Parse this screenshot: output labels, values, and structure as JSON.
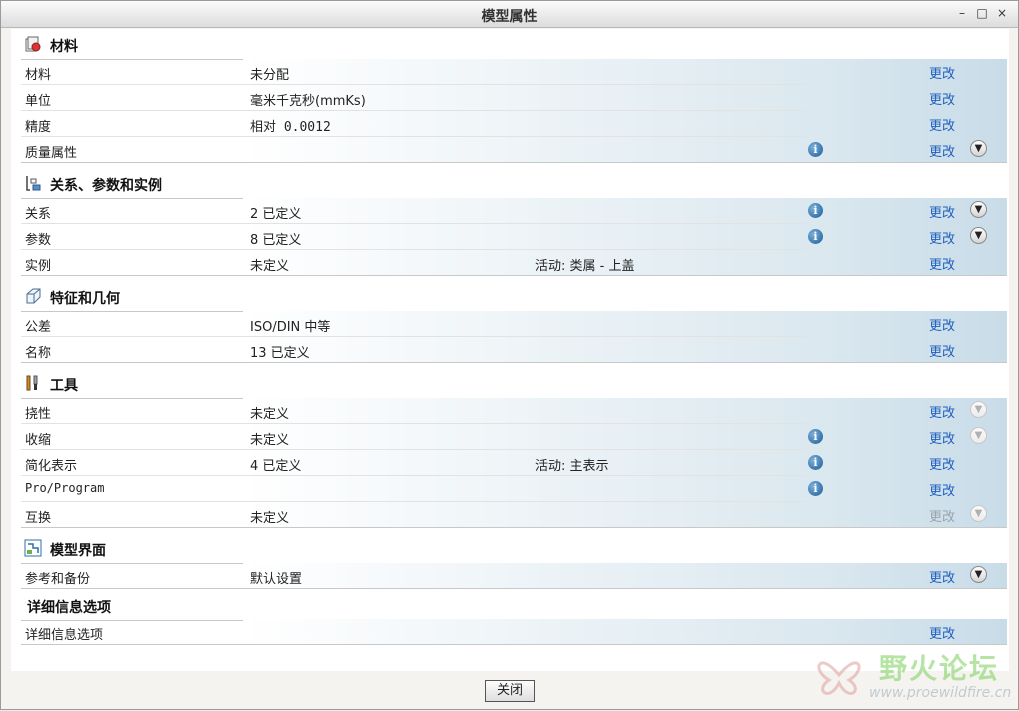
{
  "window": {
    "title": "模型属性",
    "controls": {
      "minimize": "–",
      "maximize": "□",
      "close": "×"
    }
  },
  "change_label": "更改",
  "sections": {
    "material": {
      "title": "材料",
      "rows": [
        {
          "label": "材料",
          "value": "未分配"
        },
        {
          "label": "单位",
          "value": "毫米千克秒(mmKs)"
        },
        {
          "label": "精度",
          "value": "相对 0.0012"
        },
        {
          "label": "质量属性",
          "value": ""
        }
      ]
    },
    "relations": {
      "title": "关系、参数和实例",
      "rows": [
        {
          "label": "关系",
          "value": "2 已定义"
        },
        {
          "label": "参数",
          "value": "8 已定义"
        },
        {
          "label": "实例",
          "value": "未定义",
          "extra": "活动: 类属 - 上盖"
        }
      ]
    },
    "features": {
      "title": "特征和几何",
      "rows": [
        {
          "label": "公差",
          "value": "ISO/DIN 中等"
        },
        {
          "label": "名称",
          "value": "13 已定义"
        }
      ]
    },
    "tools": {
      "title": "工具",
      "rows": [
        {
          "label": "挠性",
          "value": "未定义"
        },
        {
          "label": "收缩",
          "value": "未定义"
        },
        {
          "label": "简化表示",
          "value": "4 已定义",
          "extra": "活动: 主表示"
        },
        {
          "label": "Pro/Program",
          "value": ""
        },
        {
          "label": "互换",
          "value": "未定义"
        }
      ]
    },
    "interface": {
      "title": "模型界面",
      "rows": [
        {
          "label": "参考和备份",
          "value": "默认设置"
        }
      ]
    },
    "detail": {
      "title": "详细信息选项",
      "rows": [
        {
          "label": "详细信息选项",
          "value": ""
        }
      ]
    }
  },
  "footer": {
    "close_button": "关闭"
  },
  "watermark": {
    "title": "野火论坛",
    "url": "www.proewildfire.cn"
  },
  "icons": {
    "material": "material-icon",
    "relations": "relations-icon",
    "features": "features-icon",
    "tools": "tools-icon",
    "interface": "interface-icon",
    "info": "info-icon",
    "expand": "chevron-down-icon"
  },
  "colors": {
    "link": "#1f5fbf",
    "row_gradient_end": "#c8dce8"
  }
}
